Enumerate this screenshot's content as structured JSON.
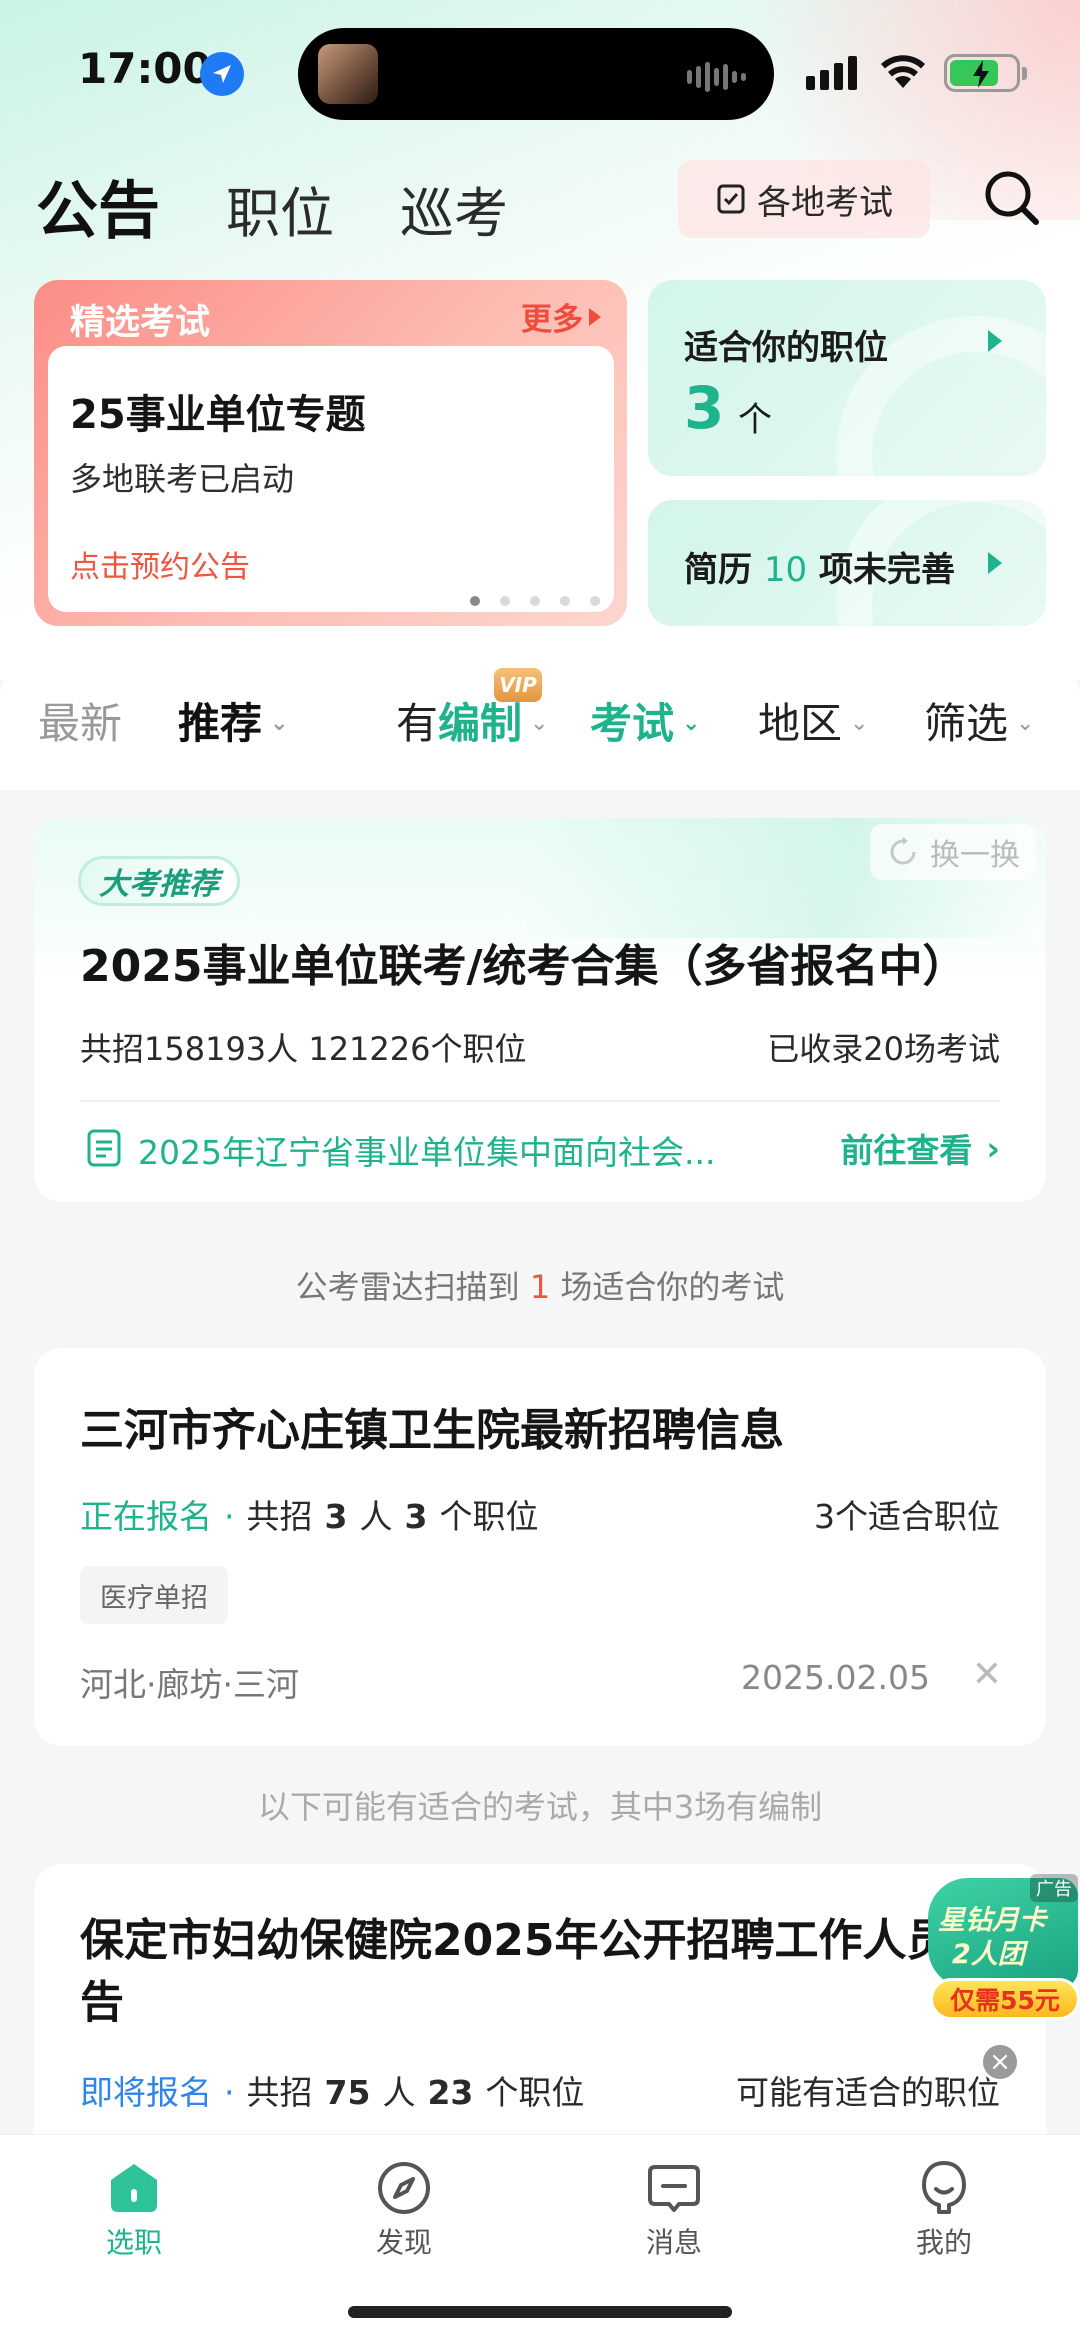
{
  "status_bar": {
    "time": "17:00"
  },
  "top_tabs": [
    {
      "label": "公告",
      "active": true
    },
    {
      "label": "职位",
      "active": false
    },
    {
      "label": "巡考",
      "active": false
    }
  ],
  "exam_button": {
    "label": "各地考试"
  },
  "featured": {
    "header": "精选考试",
    "more": "更多",
    "title": "25事业单位专题",
    "subtitle": "多地联考已启动",
    "link": "点击预约公告"
  },
  "suitable_positions": {
    "title": "适合你的职位",
    "count": "3",
    "unit": "个"
  },
  "resume": {
    "prefix": "简历",
    "count": "10",
    "suffix": "项未完善"
  },
  "filters": {
    "latest": "最新",
    "recommend": "推荐",
    "bianzhi_prefix": "有",
    "bianzhi_highlight": "编制",
    "vip": "VIP",
    "exam": "考试",
    "region": "地区",
    "filter": "筛选"
  },
  "big_card": {
    "tag": "大考推荐",
    "refresh": "换一换",
    "title": "2025事业单位联考/统考合集（多省报名中）",
    "stats": "共招158193人 121226个职位",
    "collected": "已收录20场考试",
    "notice": "2025年辽宁省事业单位集中面向社会...",
    "go": "前往查看"
  },
  "radar": {
    "prefix": "公考雷达扫描到",
    "count": "1",
    "suffix": "场适合你的考试"
  },
  "job1": {
    "title": "三河市齐心庄镇卫生院最新招聘信息",
    "status": "正在报名",
    "recruit_prefix": "共招",
    "recruit_count": "3",
    "recruit_unit": "人",
    "positions_count": "3",
    "positions_unit": "个职位",
    "fit": "3个适合职位",
    "tag": "医疗单招",
    "location": "河北·廊坊·三河",
    "date": "2025.02.05"
  },
  "maybe_text": "以下可能有适合的考试，其中3场有编制",
  "job2": {
    "title": "保定市妇幼保健院2025年公开招聘工作人员公告",
    "status": "即将报名",
    "recruit_prefix": "共招",
    "recruit_count": "75",
    "recruit_unit": "人",
    "positions_count": "23",
    "positions_unit": "个职位",
    "fit": "可能有适合的职位"
  },
  "ad": {
    "tag": "广告",
    "line1": "星钻月卡",
    "line2": "2人团",
    "price": "仅需55元"
  },
  "bottom_nav": [
    {
      "label": "选职",
      "active": true,
      "icon": "home-icon"
    },
    {
      "label": "发现",
      "active": false,
      "icon": "compass-icon"
    },
    {
      "label": "消息",
      "active": false,
      "icon": "message-icon"
    },
    {
      "label": "我的",
      "active": false,
      "icon": "profile-icon"
    }
  ],
  "colors": {
    "accent": "#1fb38d",
    "warn": "#f0553f",
    "upcoming": "#2f86e8"
  }
}
